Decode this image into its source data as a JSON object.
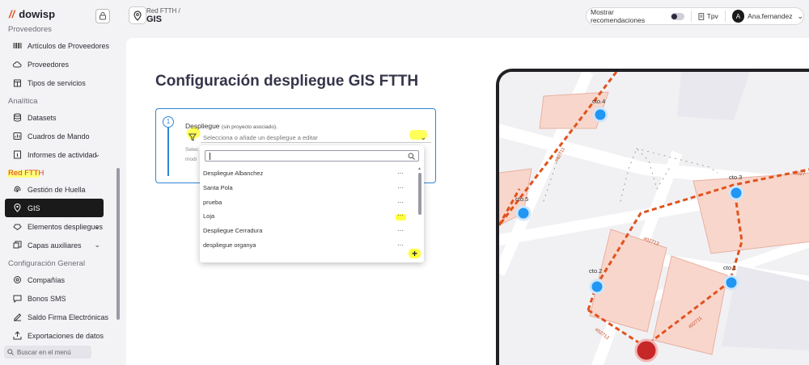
{
  "app": {
    "logo": "dowisp"
  },
  "sidebar": {
    "sections": [
      {
        "label": "Proveedores",
        "items": [
          {
            "label": "Artículos de Proveedores",
            "icon": "barcode-icon"
          },
          {
            "label": "Proveedores",
            "icon": "cloud-icon"
          },
          {
            "label": "Tipos de servicios",
            "icon": "calendar-icon"
          }
        ]
      },
      {
        "label": "Analítica",
        "items": [
          {
            "label": "Datasets",
            "icon": "database-icon"
          },
          {
            "label": "Cuadros de Mando",
            "icon": "dashboard-icon"
          },
          {
            "label": "Informes de actividad",
            "icon": "report-icon"
          }
        ]
      },
      {
        "label": "Red FTTH",
        "items": [
          {
            "label": "Gestión de Huella",
            "icon": "fingerprint-icon"
          },
          {
            "label": "GIS",
            "icon": "map-pin-icon"
          },
          {
            "label": "Elementos despliegues",
            "icon": "elements-icon"
          },
          {
            "label": "Capas auxiliares",
            "icon": "layers-icon"
          }
        ]
      },
      {
        "label": "Configuración General",
        "items": [
          {
            "label": "Compañías",
            "icon": "building-icon"
          },
          {
            "label": "Bonos SMS",
            "icon": "sms-icon"
          },
          {
            "label": "Saldo Firma Electrónicas",
            "icon": "signature-icon"
          },
          {
            "label": "Exportaciones de datos",
            "icon": "export-icon"
          }
        ]
      }
    ],
    "search_placeholder": "Buscar en el menú"
  },
  "header": {
    "breadcrumb": "Red FTTH /",
    "title": "GIS",
    "show_recommendations": "Mostrar recomendaciones",
    "tpv": "Tpv",
    "user_initial": "A",
    "user": "Ana.fernandez"
  },
  "page": {
    "title": "Configuración despliegue GIS FTTH",
    "step": "1",
    "field_label": "Despliegue",
    "field_hint": "(sin proyecto asociado).",
    "select_placeholder": "Selecciona o añade un despliegue a editar",
    "clipped_text_1": "Selec",
    "clipped_text_2": "modi",
    "options": [
      "Despliegue Albanchez",
      "Santa Pola",
      "prueba",
      "Loja",
      "Despliegue Cerradura",
      "despliegue organya"
    ],
    "option_menu": "⋯"
  },
  "map": {
    "ctos": [
      "cto.4",
      "cto.5",
      "cto.3",
      "cto.2",
      "cto.1"
    ],
    "routes": [
      "#02711",
      "#02713",
      "#02711",
      "#02712",
      "#027"
    ]
  },
  "colors": {
    "accent": "#2f86d6",
    "route": "#e0531d",
    "highlight": "#ffff3c",
    "cto": "#2196f3",
    "origin": "#c62828"
  }
}
